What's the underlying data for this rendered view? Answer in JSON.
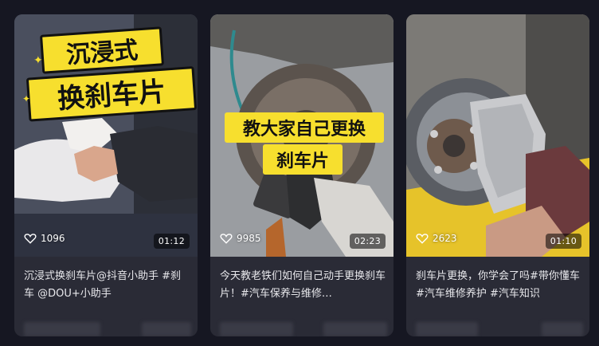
{
  "cards": [
    {
      "overlay_line1": "沉浸式",
      "overlay_line2": "换刹车片",
      "likes": "1096",
      "duration": "01:12",
      "title": "沉浸式换刹车片@抖音小助手 #刹车 @DOU+小助手"
    },
    {
      "overlay_line1": "教大家自己更换",
      "overlay_line2": "刹车片",
      "likes": "9985",
      "duration": "02:23",
      "title": "今天教老铁们如何自己动手更换刹车片！#汽车保养与维修…"
    },
    {
      "likes": "2623",
      "duration": "01:10",
      "title": "刹车片更换，你学会了吗#带你懂车#汽车维修养护 #汽车知识"
    }
  ],
  "icons": {
    "like": "heart-icon"
  },
  "colors": {
    "background": "#161722",
    "card": "#2a2b36",
    "banner_yellow": "#f7df2e"
  }
}
